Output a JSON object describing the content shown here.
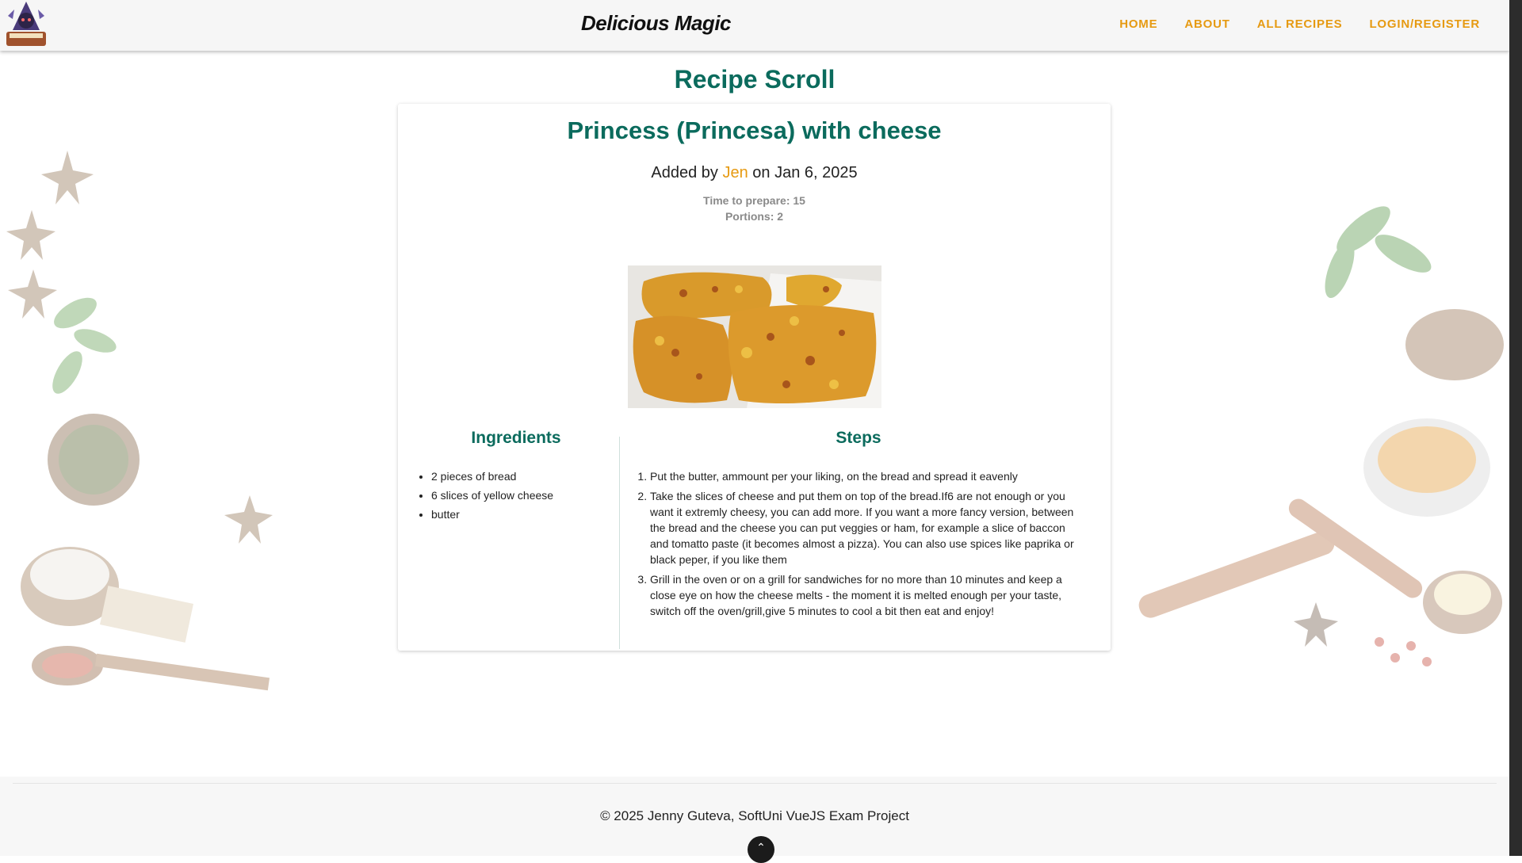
{
  "header": {
    "brand": "Delicious Magic",
    "logo_icon": "wizard-book-logo",
    "nav": [
      "HOME",
      "ABOUT",
      "ALL RECIPES",
      "LOGIN/REGISTER"
    ]
  },
  "page": {
    "title": "Recipe Scroll"
  },
  "recipe": {
    "title": "Princess (Princesa) with cheese",
    "added_prefix": "Added by",
    "author": "Jen",
    "added_suffix": "on Jan 6, 2025",
    "time": "Time to prepare: 15",
    "portions": "Portions: 2",
    "ingredients_title": "Ingredients",
    "ingredients": [
      "2 pieces of bread",
      "6 slices of yellow cheese",
      "butter"
    ],
    "steps_title": "Steps",
    "steps": [
      "Put the butter, ammount per your liking, on the bread and spread it eavenly",
      "Take the slices of cheese and put them on top of the bread.If6 are not enough or you want it extremly cheesy, you can add more. If you want a more fancy version, between the bread and the cheese you can put veggies or ham, for example a slice of baccon and tomatto paste (it becomes almost a pizza). You can also use spices like paprika or black peper, if you like them",
      "Grill in the oven or on a grill for sandwiches for no more than 10 minutes and keep a close eye on how the cheese melts - the moment it is melted enough per your taste, switch off the oven/grill,give 5 minutes to cool a bit then eat and enjoy!"
    ]
  },
  "footer": {
    "copyright": "© 2025 Jenny Guteva, SoftUni VueJS Exam Project",
    "scroll_top_icon": "chevron-up-icon"
  },
  "colors": {
    "accent": "#e69a12",
    "heading": "#0b6b5d"
  }
}
